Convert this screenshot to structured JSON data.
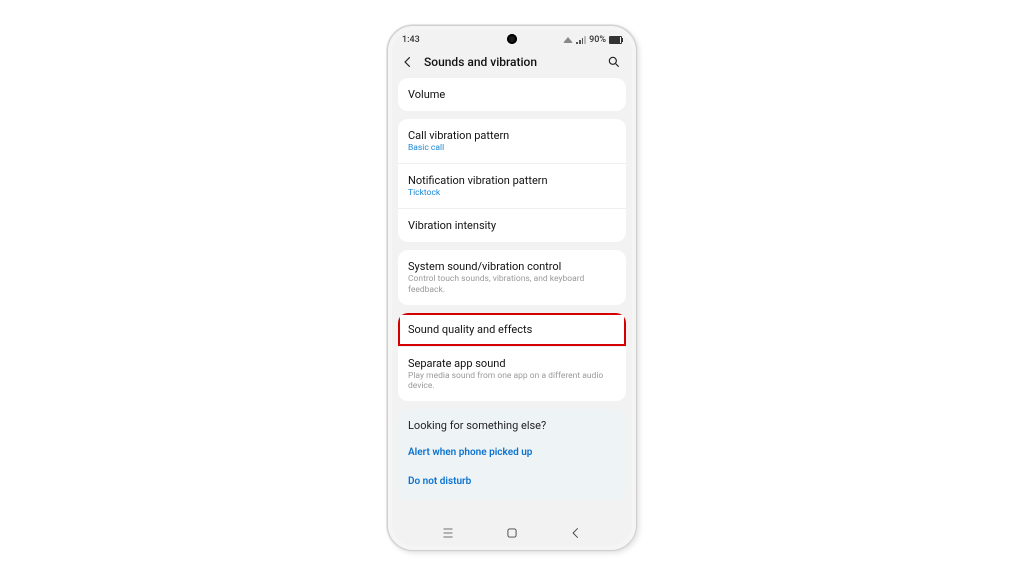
{
  "status": {
    "time": "1:43",
    "battery_pct": "90%"
  },
  "header": {
    "title": "Sounds and vibration"
  },
  "group_volume": {
    "volume": "Volume"
  },
  "group_vibration": {
    "call_pattern": "Call vibration pattern",
    "call_pattern_value": "Basic call",
    "notif_pattern": "Notification vibration pattern",
    "notif_pattern_value": "Ticktock",
    "intensity": "Vibration intensity"
  },
  "group_system": {
    "sys_control": "System sound/vibration control",
    "sys_control_sub": "Control touch sounds, vibrations, and keyboard feedback."
  },
  "group_sound": {
    "quality": "Sound quality and effects",
    "separate": "Separate app sound",
    "separate_sub": "Play media sound from one app on a different audio device."
  },
  "suggestions": {
    "heading": "Looking for something else?",
    "link1": "Alert when phone picked up",
    "link2": "Do not disturb"
  }
}
